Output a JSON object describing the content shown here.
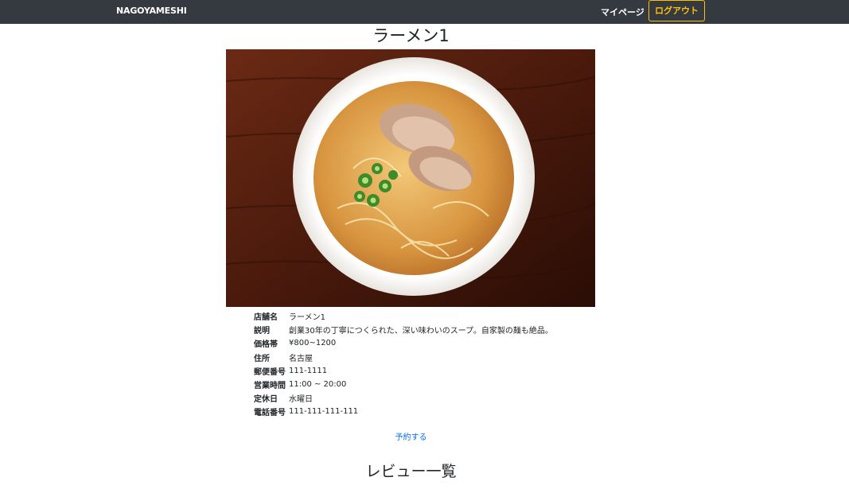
{
  "nav": {
    "brand": "NAGOYAMESHI",
    "mypage": "マイページ",
    "logout": "ログアウト"
  },
  "shop": {
    "title": "ラーメン1",
    "image_desc": "ramen-photo",
    "details": [
      {
        "label": "店舗名",
        "value": "ラーメン1"
      },
      {
        "label": "説明",
        "value": "創業30年の丁寧につくられた、深い味わいのスープ。自家製の麺も絶品。"
      },
      {
        "label": "価格帯",
        "value": "¥800~1200"
      },
      {
        "label": "住所",
        "value": "名古屋"
      },
      {
        "label": "郵便番号",
        "value": "111-1111"
      },
      {
        "label": "営業時間",
        "value": "11:00 ~ 20:00"
      },
      {
        "label": "定休日",
        "value": "水曜日"
      },
      {
        "label": "電話番号",
        "value": "111-111-111-111"
      }
    ]
  },
  "reserve_link": "予約する",
  "reviews": {
    "title": "レビュー一覧"
  },
  "colors": {
    "navbar": "#343a40",
    "logout_accent": "#ffc107",
    "link": "#0d6efd"
  }
}
